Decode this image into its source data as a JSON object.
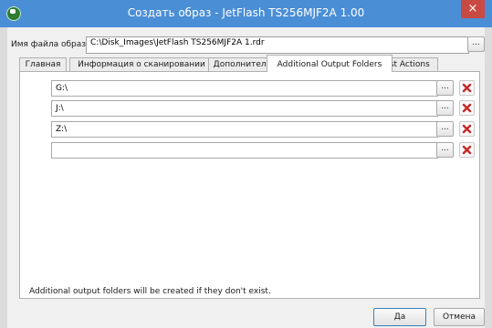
{
  "window": {
    "title": "Создать образ - JetFlash TS256MJF2A 1.00",
    "close_glyph": "×"
  },
  "file": {
    "label": "Имя файла образа:",
    "value": "C:\\Disk_Images\\JetFlash TS256MJF2A 1.rdr",
    "browse_label": "..."
  },
  "tabs": [
    {
      "label": "Главная",
      "active": false
    },
    {
      "label": "Информация о сканировании",
      "active": false
    },
    {
      "label": "Дополнительно",
      "active": false
    },
    {
      "label": "Additional Output Folders",
      "active": true
    },
    {
      "label": "Post Actions",
      "active": false
    }
  ],
  "folders": [
    {
      "value": "G:\\",
      "browse_label": "..."
    },
    {
      "value": "J:\\",
      "browse_label": "..."
    },
    {
      "value": "Z:\\",
      "browse_label": "..."
    },
    {
      "value": "",
      "browse_label": "..."
    }
  ],
  "hint": "Additional output folders will be created if they don't exist.",
  "buttons": {
    "ok_label": "Да",
    "cancel_label": "Отмена"
  },
  "colors": {
    "titlebar": "#4a8ed6",
    "close": "#c94a43",
    "delete_x": "#c62828"
  }
}
